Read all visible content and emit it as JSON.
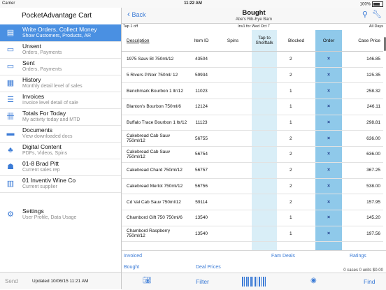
{
  "status": {
    "carrier": "Carrier",
    "time": "11:22 AM",
    "battery": "100%"
  },
  "sidebar": {
    "title": "PocketAdvantage Cart",
    "items": [
      {
        "title": "Write Orders, Collect Money",
        "sub": "Show Customers, Products, AR",
        "icon": "clipboard-icon"
      },
      {
        "title": "Unsent",
        "sub": "Orders, Payments",
        "icon": "inbox-icon"
      },
      {
        "title": "Sent",
        "sub": "Orders, Payments",
        "icon": "outbox-icon"
      },
      {
        "title": "History",
        "sub": "Monthly detail level of sales",
        "icon": "calendar-icon"
      },
      {
        "title": "Invoices",
        "sub": "Invoice level detail of sale",
        "icon": "list-icon"
      },
      {
        "title": "Totals For Today",
        "sub": "My activity today and MTD",
        "icon": "tally-icon"
      },
      {
        "title": "Documents",
        "sub": "View downloaded docs",
        "icon": "folder-icon"
      },
      {
        "title": "Digital Content",
        "sub": "PDFs, Videos, Spins",
        "icon": "tree-icon"
      },
      {
        "title": "01-8 Brad Pitt",
        "sub": "Current sales rep",
        "icon": "person-icon"
      },
      {
        "title": "01 Inventiv Wine Co",
        "sub": "Current supplier",
        "icon": "building-icon"
      },
      {
        "title": "Settings",
        "sub": "User Profile, Data Usage",
        "icon": "gear-icon"
      }
    ],
    "send": "Send",
    "updated": "Updated 10/06/15 11:21 AM"
  },
  "nav": {
    "back": "Back",
    "title": "Bought",
    "subtitle": "Abe's Rib-Eye Barn",
    "info_left": "Tap 1 off",
    "info_center": "Inv1 for Wed Oct 7",
    "info_right": "All Days"
  },
  "table": {
    "headers": {
      "description": "Description",
      "item_id": "Item ID",
      "spins": "Spins",
      "tap": "Tap to Shelftalk",
      "blocked": "Blocked",
      "order": "Order",
      "case_price": "Case Price"
    },
    "rows": [
      {
        "desc": "1975 Sauv Bl 750ml/12",
        "id": "43504",
        "blocked": "2",
        "order": "×",
        "price": "146.85"
      },
      {
        "desc": "5 Rivers P.Noir 750ml/ 12",
        "id": "59934",
        "blocked": "2",
        "order": "×",
        "price": "125.35"
      },
      {
        "desc": "Benchmark Bourbon 1 ltr/12",
        "id": "11023",
        "blocked": "1",
        "order": "×",
        "price": "258.32"
      },
      {
        "desc": "Blanton's Bourbon 750ml/6",
        "id": "12124",
        "blocked": "1",
        "order": "×",
        "price": "246.11"
      },
      {
        "desc": "Buffalo Trace Bourbon 1 ltr/12",
        "id": "11123",
        "blocked": "1",
        "order": "×",
        "price": "298.81"
      },
      {
        "desc": "Cakebread Cab Sauv 750ml/12",
        "id": "56755",
        "blocked": "2",
        "order": "×",
        "price": "636.00"
      },
      {
        "desc": "Cakebread Cab Sauv 750ml/12",
        "id": "56754",
        "blocked": "2",
        "order": "×",
        "price": "636.00"
      },
      {
        "desc": "Cakebread Chard 750ml/12",
        "id": "56757",
        "blocked": "2",
        "order": "×",
        "price": "367.25"
      },
      {
        "desc": "Cakebread Merlot 750ml/12",
        "id": "56756",
        "blocked": "2",
        "order": "×",
        "price": "538.00"
      },
      {
        "desc": "Cd Val Cab Sauv 750ml/12",
        "id": "59114",
        "blocked": "2",
        "order": "×",
        "price": "157.95"
      },
      {
        "desc": "Chambord Gift 750 750ml/6",
        "id": "13540",
        "blocked": "1",
        "order": "×",
        "price": "145.20"
      },
      {
        "desc": "Chambord Raspberry 750ml/12",
        "id": "13540",
        "blocked": "1",
        "order": "×",
        "price": "197.56"
      }
    ]
  },
  "footer": {
    "invoiced": "Invoiced",
    "fam_deals": "Fam Deals",
    "ratings": "Ratings",
    "bought": "Bought",
    "deal_prices": "Deal Prices",
    "summary": "0 cases 0 units $0.00"
  },
  "tabbar": {
    "filter": "Filter",
    "find": "Find"
  }
}
